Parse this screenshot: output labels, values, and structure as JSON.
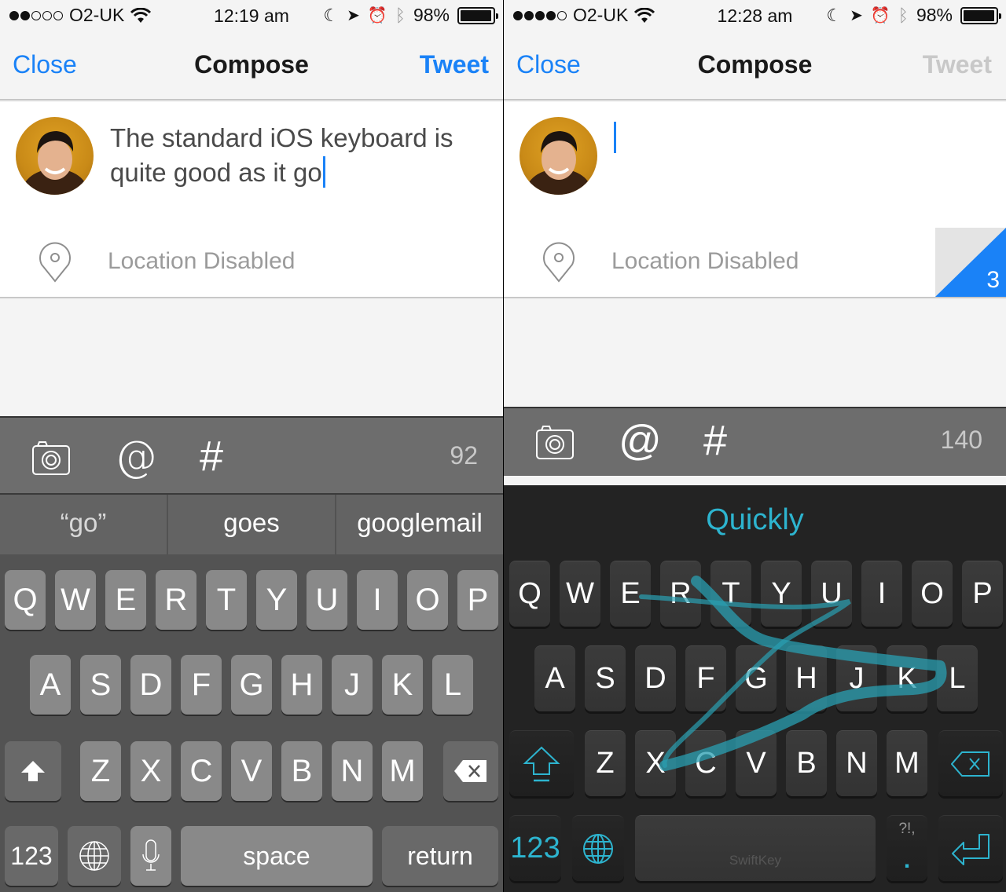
{
  "left": {
    "status": {
      "carrier": "O2-UK",
      "signal_bars_filled": 2,
      "signal_bars_total": 5,
      "time": "12:19 am",
      "battery": "98%",
      "battery_level": 0.98
    },
    "nav": {
      "close": "Close",
      "title": "Compose",
      "tweet": "Tweet",
      "tweet_enabled": true
    },
    "compose": {
      "text": "The standard iOS keyboard is quite good as it go",
      "location": "Location Disabled"
    },
    "toolbar": {
      "icons": [
        "camera-icon",
        "at-icon",
        "hashtag-icon"
      ],
      "char_count": "92",
      "at": "@",
      "hash": "#"
    },
    "suggestions": [
      "“go”",
      "goes",
      "googlemail"
    ],
    "keyboard": {
      "row1": [
        "Q",
        "W",
        "E",
        "R",
        "T",
        "Y",
        "U",
        "I",
        "O",
        "P"
      ],
      "row2": [
        "A",
        "S",
        "D",
        "F",
        "G",
        "H",
        "J",
        "K",
        "L"
      ],
      "row3": [
        "Z",
        "X",
        "C",
        "V",
        "B",
        "N",
        "M"
      ],
      "numbers": "123",
      "space": "space",
      "return": "return"
    }
  },
  "right": {
    "status": {
      "carrier": "O2-UK",
      "signal_bars_filled": 4,
      "signal_bars_total": 5,
      "time": "12:28 am",
      "battery": "98%",
      "battery_level": 0.98
    },
    "nav": {
      "close": "Close",
      "title": "Compose",
      "tweet": "Tweet",
      "tweet_enabled": false
    },
    "compose": {
      "text": "",
      "location": "Location Disabled",
      "drafts_count": "3"
    },
    "toolbar": {
      "icons": [
        "camera-icon",
        "at-icon",
        "hashtag-icon"
      ],
      "char_count": "140",
      "at": "@",
      "hash": "#"
    },
    "prediction": "Quickly",
    "keyboard": {
      "row1": [
        "Q",
        "W",
        "E",
        "R",
        "T",
        "Y",
        "U",
        "I",
        "O",
        "P"
      ],
      "row2": [
        "A",
        "S",
        "D",
        "F",
        "G",
        "H",
        "J",
        "K",
        "L"
      ],
      "row3": [
        "Z",
        "X",
        "C",
        "V",
        "B",
        "N",
        "M"
      ],
      "numbers": "123",
      "space_brand": "SwiftKey",
      "punct_top": "?!,",
      "punct_main": "."
    },
    "swipe_path_keys": [
      "E",
      "R",
      "T",
      "Y",
      "U",
      "I",
      "U",
      "L",
      "K",
      "J",
      "H",
      "C",
      "X",
      "G",
      "U"
    ]
  },
  "colors": {
    "ios_blue": "#1a82f7",
    "swiftkey_teal": "#2db4cf",
    "disabled_gray": "#c8c8c8"
  }
}
